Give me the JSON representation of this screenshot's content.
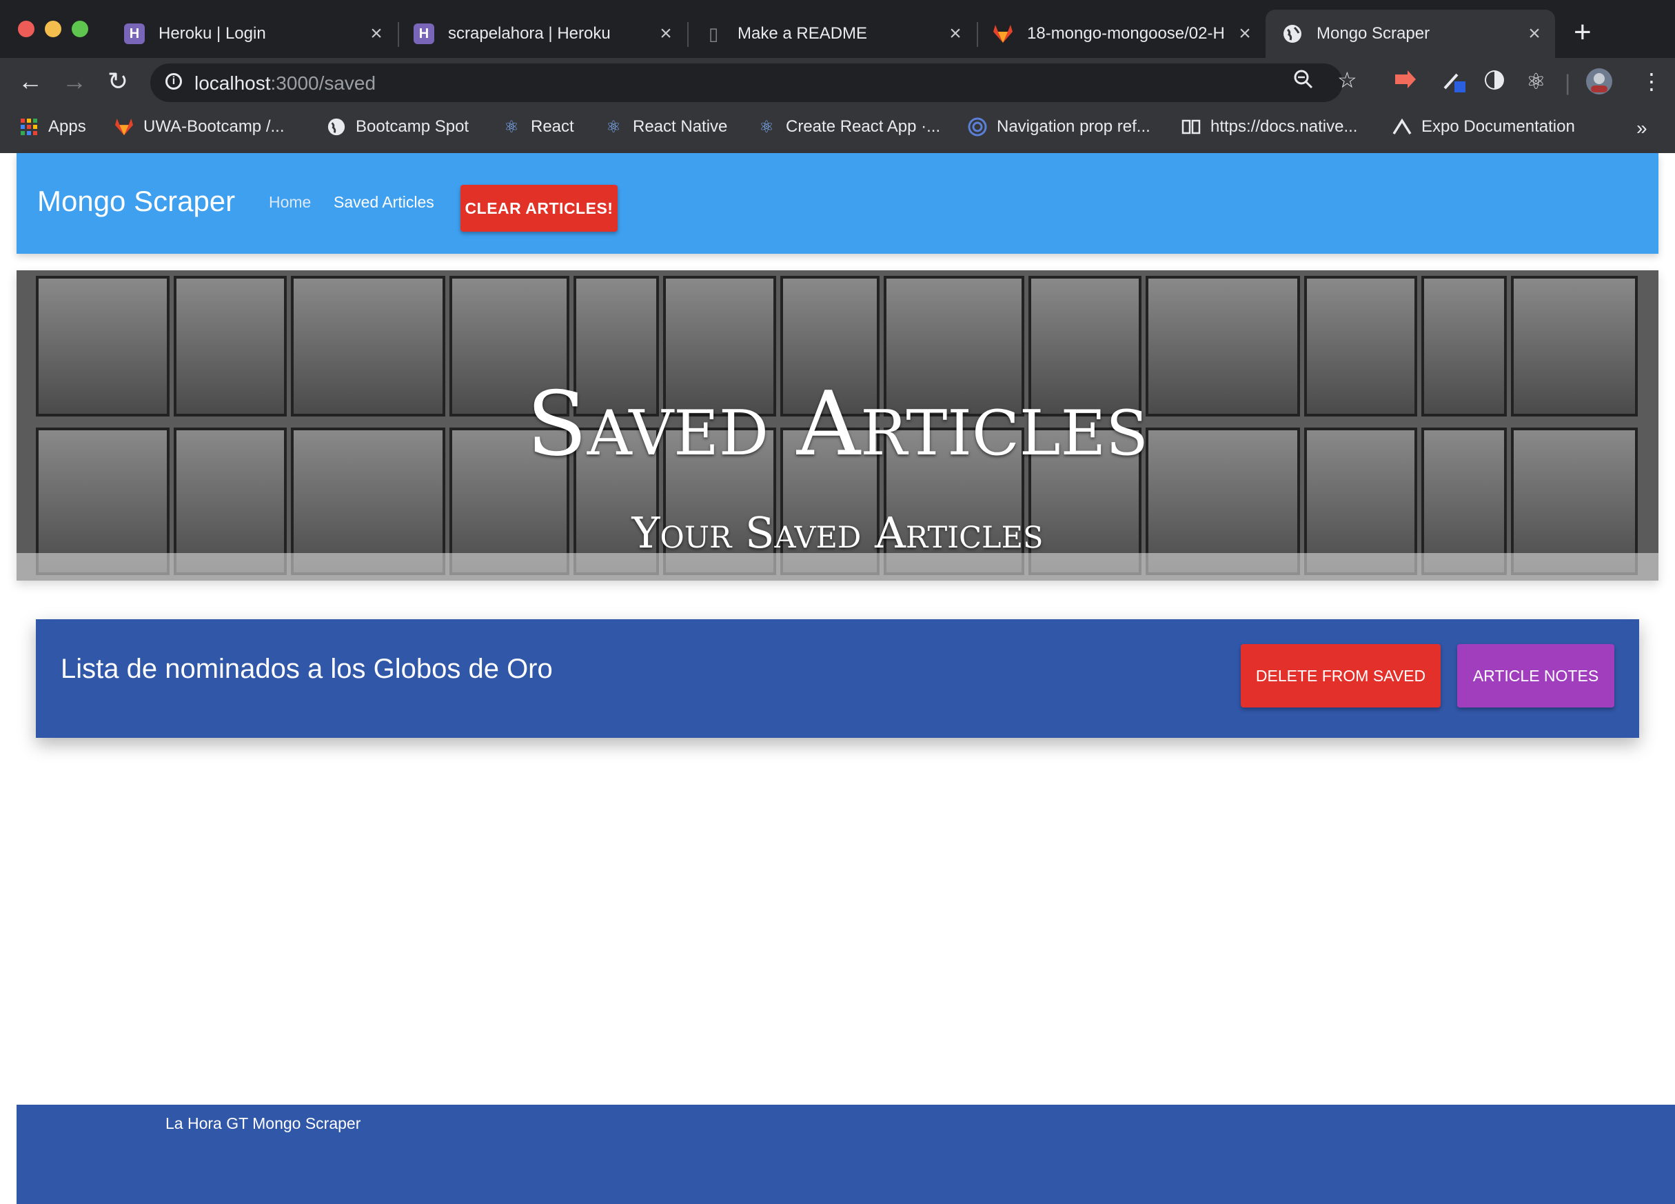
{
  "browser": {
    "tabs": [
      {
        "title": "Heroku | Login",
        "icon": "heroku-icon"
      },
      {
        "title": "scrapelahora | Heroku",
        "icon": "heroku-icon"
      },
      {
        "title": "Make a README",
        "icon": "document-icon"
      },
      {
        "title": "18-mongo-mongoose/02-H",
        "icon": "gitlab-icon"
      },
      {
        "title": "Mongo Scraper",
        "icon": "globe-icon"
      }
    ],
    "active_tab_index": 4,
    "url_host": "localhost",
    "url_path": ":3000/saved",
    "bookmarks": [
      {
        "label": "Apps",
        "icon": "apps-grid-icon"
      },
      {
        "label": "UWA-Bootcamp /...",
        "icon": "gitlab-icon"
      },
      {
        "label": "Bootcamp Spot",
        "icon": "globe-icon"
      },
      {
        "label": "React",
        "icon": "react-icon"
      },
      {
        "label": "React Native",
        "icon": "react-icon"
      },
      {
        "label": "Create React App ·...",
        "icon": "react-icon"
      },
      {
        "label": "Navigation prop ref...",
        "icon": "react-navigation-icon"
      },
      {
        "label": "https://docs.native...",
        "icon": "book-icon"
      },
      {
        "label": "Expo Documentation",
        "icon": "expo-icon"
      }
    ]
  },
  "navbar": {
    "brand": "Mongo Scraper",
    "links": [
      "Home",
      "Saved Articles"
    ],
    "clear_button": "CLEAR ARTICLES!"
  },
  "hero": {
    "title": "Saved Articles",
    "subtitle": "Your Saved Articles"
  },
  "articles": [
    {
      "title": "Lista de nominados a los Globos de Oro",
      "delete_label": "DELETE FROM SAVED",
      "notes_label": "ARTICLE NOTES"
    }
  ],
  "footer": {
    "text": "La Hora GT Mongo Scraper"
  },
  "colors": {
    "navbar": "#3fa0f0",
    "card": "#3157a8",
    "danger": "#e3302a",
    "notes": "#a13ebe"
  }
}
